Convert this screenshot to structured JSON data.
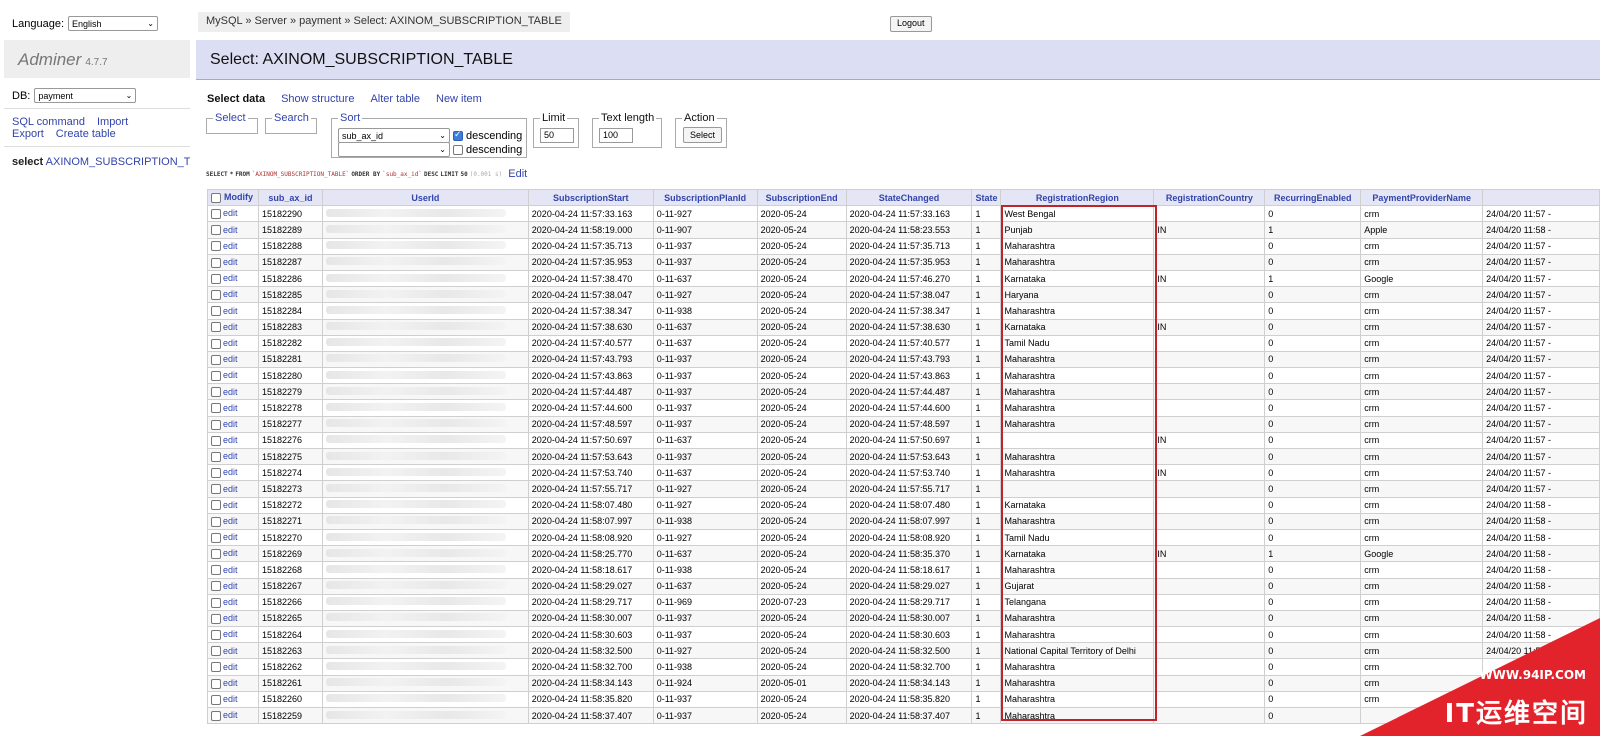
{
  "sidebar": {
    "language_label": "Language:",
    "language_value": "English",
    "brand": "Adminer",
    "version": "4.7.7",
    "db_label": "DB:",
    "db_value": "payment",
    "links": [
      "SQL command",
      "Import",
      "Export",
      "Create table"
    ],
    "table_prefix": "select",
    "table_name": "AXINOM_SUBSCRIPTION_TA"
  },
  "breadcrumb": "MySQL » Server » payment » Select: AXINOM_SUBSCRIPTION_TABLE",
  "logout_label": "Logout",
  "page_title": "Select: AXINOM_SUBSCRIPTION_TABLE",
  "tabs": [
    "Select data",
    "Show structure",
    "Alter table",
    "New item"
  ],
  "form": {
    "select_legend": "Select",
    "search_legend": "Search",
    "sort_legend": "Sort",
    "sort_column": "sub_ax_id",
    "descending_label": "descending",
    "limit_legend": "Limit",
    "limit_value": "50",
    "text_length_legend": "Text length",
    "text_length_value": "100",
    "action_legend": "Action",
    "action_button": "Select"
  },
  "sql": {
    "parts": [
      "SELECT",
      "*",
      "FROM",
      "`AXINOM_SUBSCRIPTION_TABLE`",
      "ORDER BY",
      "`sub_ax_id`",
      "DESC",
      "LIMIT",
      "50",
      "(0.001 s)"
    ],
    "edit_label": "Edit"
  },
  "table": {
    "columns": [
      "Modify",
      "sub_ax_id",
      "UserId",
      "SubscriptionStart",
      "SubscriptionPlanId",
      "SubscriptionEnd",
      "StateChanged",
      "State",
      "RegistrationRegion",
      "RegistrationCountry",
      "RecurringEnabled",
      "PaymentProviderName",
      ""
    ],
    "edit_label": "edit",
    "rows": [
      [
        "15182290",
        "2020-04-24 11:57:33.163",
        "0-11-927",
        "2020-05-24",
        "2020-04-24 11:57:33.163",
        "1",
        "West Bengal",
        "",
        "0",
        "crm",
        "24/04/20 11:57 -"
      ],
      [
        "15182289",
        "2020-04-24 11:58:19.000",
        "0-11-907",
        "2020-05-24",
        "2020-04-24 11:58:23.553",
        "1",
        "Punjab",
        "IN",
        "1",
        "Apple",
        "24/04/20 11:58 -"
      ],
      [
        "15182288",
        "2020-04-24 11:57:35.713",
        "0-11-937",
        "2020-05-24",
        "2020-04-24 11:57:35.713",
        "1",
        "Maharashtra",
        "",
        "0",
        "crm",
        "24/04/20 11:57 -"
      ],
      [
        "15182287",
        "2020-04-24 11:57:35.953",
        "0-11-937",
        "2020-05-24",
        "2020-04-24 11:57:35.953",
        "1",
        "Maharashtra",
        "",
        "0",
        "crm",
        "24/04/20 11:57 -"
      ],
      [
        "15182286",
        "2020-04-24 11:57:38.470",
        "0-11-637",
        "2020-05-24",
        "2020-04-24 11:57:46.270",
        "1",
        "Karnataka",
        "IN",
        "1",
        "Google",
        "24/04/20 11:57 -"
      ],
      [
        "15182285",
        "2020-04-24 11:57:38.047",
        "0-11-927",
        "2020-05-24",
        "2020-04-24 11:57:38.047",
        "1",
        "Haryana",
        "",
        "0",
        "crm",
        "24/04/20 11:57 -"
      ],
      [
        "15182284",
        "2020-04-24 11:57:38.347",
        "0-11-938",
        "2020-05-24",
        "2020-04-24 11:57:38.347",
        "1",
        "Maharashtra",
        "",
        "0",
        "crm",
        "24/04/20 11:57 -"
      ],
      [
        "15182283",
        "2020-04-24 11:57:38.630",
        "0-11-637",
        "2020-05-24",
        "2020-04-24 11:57:38.630",
        "1",
        "Karnataka",
        "IN",
        "0",
        "crm",
        "24/04/20 11:57 -"
      ],
      [
        "15182282",
        "2020-04-24 11:57:40.577",
        "0-11-637",
        "2020-05-24",
        "2020-04-24 11:57:40.577",
        "1",
        "Tamil Nadu",
        "",
        "0",
        "crm",
        "24/04/20 11:57 -"
      ],
      [
        "15182281",
        "2020-04-24 11:57:43.793",
        "0-11-937",
        "2020-05-24",
        "2020-04-24 11:57:43.793",
        "1",
        "Maharashtra",
        "",
        "0",
        "crm",
        "24/04/20 11:57 -"
      ],
      [
        "15182280",
        "2020-04-24 11:57:43.863",
        "0-11-937",
        "2020-05-24",
        "2020-04-24 11:57:43.863",
        "1",
        "Maharashtra",
        "",
        "0",
        "crm",
        "24/04/20 11:57 -"
      ],
      [
        "15182279",
        "2020-04-24 11:57:44.487",
        "0-11-937",
        "2020-05-24",
        "2020-04-24 11:57:44.487",
        "1",
        "Maharashtra",
        "",
        "0",
        "crm",
        "24/04/20 11:57 -"
      ],
      [
        "15182278",
        "2020-04-24 11:57:44.600",
        "0-11-937",
        "2020-05-24",
        "2020-04-24 11:57:44.600",
        "1",
        "Maharashtra",
        "",
        "0",
        "crm",
        "24/04/20 11:57 -"
      ],
      [
        "15182277",
        "2020-04-24 11:57:48.597",
        "0-11-937",
        "2020-05-24",
        "2020-04-24 11:57:48.597",
        "1",
        "Maharashtra",
        "",
        "0",
        "crm",
        "24/04/20 11:57 -"
      ],
      [
        "15182276",
        "2020-04-24 11:57:50.697",
        "0-11-637",
        "2020-05-24",
        "2020-04-24 11:57:50.697",
        "1",
        "",
        "IN",
        "0",
        "crm",
        "24/04/20 11:57 -"
      ],
      [
        "15182275",
        "2020-04-24 11:57:53.643",
        "0-11-937",
        "2020-05-24",
        "2020-04-24 11:57:53.643",
        "1",
        "Maharashtra",
        "",
        "0",
        "crm",
        "24/04/20 11:57 -"
      ],
      [
        "15182274",
        "2020-04-24 11:57:53.740",
        "0-11-637",
        "2020-05-24",
        "2020-04-24 11:57:53.740",
        "1",
        "Maharashtra",
        "IN",
        "0",
        "crm",
        "24/04/20 11:57 -"
      ],
      [
        "15182273",
        "2020-04-24 11:57:55.717",
        "0-11-927",
        "2020-05-24",
        "2020-04-24 11:57:55.717",
        "1",
        "",
        "",
        "0",
        "crm",
        "24/04/20 11:57 -"
      ],
      [
        "15182272",
        "2020-04-24 11:58:07.480",
        "0-11-927",
        "2020-05-24",
        "2020-04-24 11:58:07.480",
        "1",
        "Karnataka",
        "",
        "0",
        "crm",
        "24/04/20 11:58 -"
      ],
      [
        "15182271",
        "2020-04-24 11:58:07.997",
        "0-11-938",
        "2020-05-24",
        "2020-04-24 11:58:07.997",
        "1",
        "Maharashtra",
        "",
        "0",
        "crm",
        "24/04/20 11:58 -"
      ],
      [
        "15182270",
        "2020-04-24 11:58:08.920",
        "0-11-927",
        "2020-05-24",
        "2020-04-24 11:58:08.920",
        "1",
        "Tamil Nadu",
        "",
        "0",
        "crm",
        "24/04/20 11:58 -"
      ],
      [
        "15182269",
        "2020-04-24 11:58:25.770",
        "0-11-637",
        "2020-05-24",
        "2020-04-24 11:58:35.370",
        "1",
        "Karnataka",
        "IN",
        "1",
        "Google",
        "24/04/20 11:58 -"
      ],
      [
        "15182268",
        "2020-04-24 11:58:18.617",
        "0-11-938",
        "2020-05-24",
        "2020-04-24 11:58:18.617",
        "1",
        "Maharashtra",
        "",
        "0",
        "crm",
        "24/04/20 11:58 -"
      ],
      [
        "15182267",
        "2020-04-24 11:58:29.027",
        "0-11-637",
        "2020-05-24",
        "2020-04-24 11:58:29.027",
        "1",
        "Gujarat",
        "",
        "0",
        "crm",
        "24/04/20 11:58 -"
      ],
      [
        "15182266",
        "2020-04-24 11:58:29.717",
        "0-11-969",
        "2020-07-23",
        "2020-04-24 11:58:29.717",
        "1",
        "Telangana",
        "",
        "0",
        "crm",
        "24/04/20 11:58 -"
      ],
      [
        "15182265",
        "2020-04-24 11:58:30.007",
        "0-11-937",
        "2020-05-24",
        "2020-04-24 11:58:30.007",
        "1",
        "Maharashtra",
        "",
        "0",
        "crm",
        "24/04/20 11:58 -"
      ],
      [
        "15182264",
        "2020-04-24 11:58:30.603",
        "0-11-937",
        "2020-05-24",
        "2020-04-24 11:58:30.603",
        "1",
        "Maharashtra",
        "",
        "0",
        "crm",
        "24/04/20 11:58 -"
      ],
      [
        "15182263",
        "2020-04-24 11:58:32.500",
        "0-11-927",
        "2020-05-24",
        "2020-04-24 11:58:32.500",
        "1",
        "National Capital Territory of Delhi",
        "",
        "0",
        "crm",
        "24/04/20 11:58 -"
      ],
      [
        "15182262",
        "2020-04-24 11:58:32.700",
        "0-11-938",
        "2020-05-24",
        "2020-04-24 11:58:32.700",
        "1",
        "Maharashtra",
        "",
        "0",
        "crm",
        ""
      ],
      [
        "15182261",
        "2020-04-24 11:58:34.143",
        "0-11-924",
        "2020-05-01",
        "2020-04-24 11:58:34.143",
        "1",
        "Maharashtra",
        "",
        "0",
        "crm",
        ""
      ],
      [
        "15182260",
        "2020-04-24 11:58:35.820",
        "0-11-937",
        "2020-05-24",
        "2020-04-24 11:58:35.820",
        "1",
        "Maharashtra",
        "",
        "0",
        "crm",
        ""
      ],
      [
        "15182259",
        "2020-04-24 11:58:37.407",
        "0-11-937",
        "2020-05-24",
        "2020-04-24 11:58:37.407",
        "1",
        "Maharashtra",
        "",
        "0",
        "",
        ""
      ]
    ]
  },
  "watermark": {
    "url": "WWW.94IP.COM",
    "text": "IT运维空间",
    "color": "#e3232b"
  },
  "colors": {
    "header_bg": "#dcdff3",
    "link": "#3344aa",
    "highlight_border": "#c0242b"
  }
}
